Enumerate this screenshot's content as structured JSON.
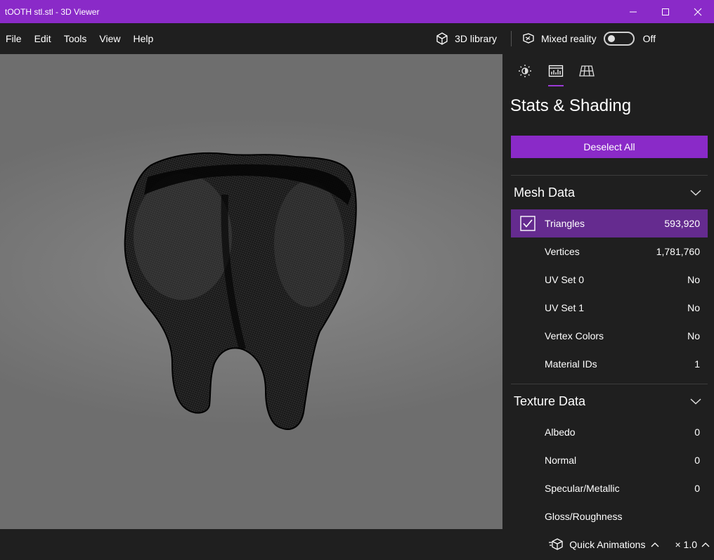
{
  "window": {
    "title": "tOOTH stl.stl - 3D Viewer",
    "controls": [
      "minimize-icon",
      "maximize-icon",
      "close-icon"
    ]
  },
  "menu": {
    "items": [
      "File",
      "Edit",
      "Tools",
      "View",
      "Help"
    ],
    "library_label": "3D library",
    "mixed_reality_label": "Mixed reality",
    "toggle_state": "Off"
  },
  "panel": {
    "tabs": [
      {
        "icon": "lighting-icon",
        "active": false
      },
      {
        "icon": "stats-icon",
        "active": true
      },
      {
        "icon": "grid-icon",
        "active": false
      }
    ],
    "title": "Stats & Shading",
    "deselect_label": "Deselect All",
    "mesh_section": {
      "title": "Mesh Data",
      "rows": [
        {
          "label": "Triangles",
          "value": "593,920",
          "selected": true
        },
        {
          "label": "Vertices",
          "value": "1,781,760"
        },
        {
          "label": "UV Set 0",
          "value": "No"
        },
        {
          "label": "UV Set 1",
          "value": "No"
        },
        {
          "label": "Vertex Colors",
          "value": "No"
        },
        {
          "label": "Material IDs",
          "value": "1"
        }
      ]
    },
    "texture_section": {
      "title": "Texture Data",
      "rows": [
        {
          "label": "Albedo",
          "value": "0"
        },
        {
          "label": "Normal",
          "value": "0"
        },
        {
          "label": "Specular/Metallic",
          "value": "0"
        },
        {
          "label": "Gloss/Roughness",
          "value": ""
        }
      ]
    }
  },
  "bottom": {
    "quick_animations_label": "Quick Animations",
    "speed_label": "× 1.0"
  },
  "colors": {
    "accent": "#8a2ac8",
    "selected_row": "#652b8f",
    "background": "#1f1f1f"
  }
}
